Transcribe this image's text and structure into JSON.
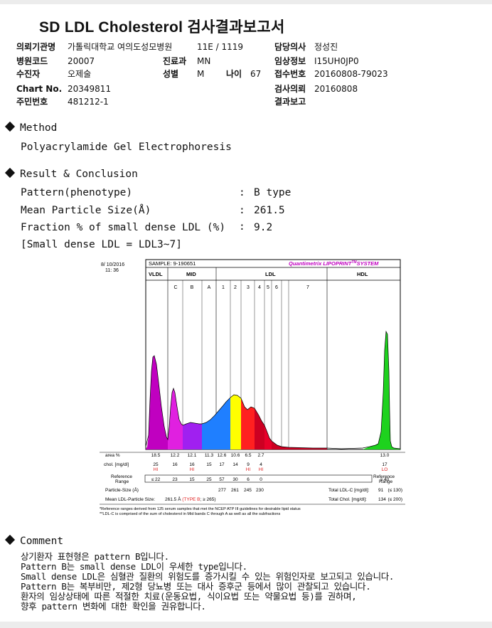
{
  "report": {
    "title": "SD LDL Cholesterol 검사결과보고서"
  },
  "header": {
    "institution": {
      "label": "의뢰기관명",
      "value": "가톨릭대학교 여의도성모병원"
    },
    "ward": {
      "value": "11E / 1119"
    },
    "doctor": {
      "label": "담당의사",
      "value": "정성진"
    },
    "hospital_code": {
      "label": "병원코드",
      "value": "20007"
    },
    "department": {
      "label": "진료과",
      "value": "MN"
    },
    "clinical_info": {
      "label": "임상정보",
      "value": "I15UH0JP0"
    },
    "patient": {
      "label": "수진자",
      "value": "오제술"
    },
    "sex": {
      "label": "성별",
      "value": "M"
    },
    "age": {
      "label": "나이",
      "value": "67"
    },
    "receipt_no": {
      "label": "접수번호",
      "value": "20160808-79023"
    },
    "chart_no": {
      "label": "Chart No.",
      "value": "20349811"
    },
    "request_date": {
      "label": "검사의뢰",
      "value": "20160808"
    },
    "resident_no": {
      "label": "주민번호",
      "value": "481212-1"
    },
    "result_report": {
      "label": "결과보고",
      "value": ""
    }
  },
  "method": {
    "heading": "Method",
    "text": "Polyacrylamide Gel Electrophoresis"
  },
  "result": {
    "heading": "Result & Conclusion",
    "rows": [
      {
        "label": "Pattern(phenotype)",
        "sep": ":",
        "value": "B type"
      },
      {
        "label": "Mean Particle Size(Å)",
        "sep": ":",
        "value": "261.5"
      },
      {
        "label": "Fraction % of small dense LDL (%)",
        "sep": ":",
        "value": "9.2"
      }
    ],
    "note": "[Small dense LDL = LDL3~7]"
  },
  "chart_data": {
    "type": "area",
    "date": "8/ 10/2016",
    "time": "11: 36",
    "sample": "SAMPLE:   9-190651",
    "brand": "Quantimetrix LIPOPRINT",
    "brand_tm": "TM",
    "brand_suffix": "SYSTEM",
    "groups": [
      "VLDL",
      "MID",
      "LDL",
      "HDL"
    ],
    "bands": [
      "C",
      "B",
      "A",
      "1",
      "2",
      "3",
      "4",
      "5",
      "6",
      "7"
    ],
    "colors": {
      "vldl": "#c000c0",
      "c": "#e020e0",
      "b": "#a020f0",
      "a": "#1f7fff",
      "ldl1": "#ffff00",
      "ldl2": "#ff2020",
      "ldl3": "#cc0022",
      "hdl": "#1ed21e",
      "label_red": "#e02020",
      "brand": "#c000c0"
    },
    "table": {
      "area_label": "area %",
      "area": [
        "18.5",
        "12.2",
        "12.1",
        "11.3",
        "12.6",
        "10.6",
        "6.5",
        "2.7",
        "",
        "",
        "13.0"
      ],
      "chol_label": "chol. [mg/dl]",
      "chol": [
        "25",
        "16",
        "16",
        "15",
        "17",
        "14",
        "9",
        "4",
        "",
        "",
        "17"
      ],
      "flags": [
        "HI",
        "",
        "HI",
        "",
        "",
        "",
        "HI",
        "HI",
        "",
        "",
        "LO"
      ],
      "ref_label_1": "Reference",
      "ref_label_2": "Range",
      "ref": [
        "≤ 22",
        "23",
        "15",
        "25",
        "57",
        "30",
        "6",
        "0",
        "",
        "",
        "≥ 40"
      ],
      "particle_size_label": "Particle-Size (Å)",
      "particle_sizes": [
        "277",
        "261",
        "245",
        "230"
      ],
      "total_ldl_label": "Total LDL-C [mg/dl]:",
      "total_ldl": "91",
      "total_ldl_ref": "(≤ 130)",
      "total_chol_label": "Total Chol. [mg/dl]:",
      "total_chol": "134",
      "total_chol_ref": "(≤ 200)",
      "mean_label": "Mean LDL-Particle Size:",
      "mean_value": "261.5 Å",
      "mean_type": "(TYPE B",
      "mean_ref": "; ≥ 265)"
    },
    "footnote_1": "*Reference ranges derived from 125 serum samples that met the NCEP ATP III guidelines for desirable lipid status",
    "footnote_2": "**LDL-C is comprised of the sum of cholesterol in Mid bands C through A as well as all the subfractions"
  },
  "comment": {
    "heading": "Comment",
    "lines": [
      "상기환자 표현형은 pattern B입니다.",
      "Pattern B는 small dense LDL이 우세한 type입니다.",
      "Small dense LDL은 심혈관 질환의 위험도를 증가시킬 수 있는 위험인자로 보고되고 있습니다.",
      "Pattern B는 복부비만, 제2형 당뇨병 또는 대사 증후군 등에서 많이 관찰되고 있습니다.",
      "환자의 임상상태에 따른 적절한 치료(운동요법, 식이요법 또는 약물요법 등)를 권하며,",
      "향후 pattern 변화에 대한 확인을 권유합니다."
    ]
  }
}
